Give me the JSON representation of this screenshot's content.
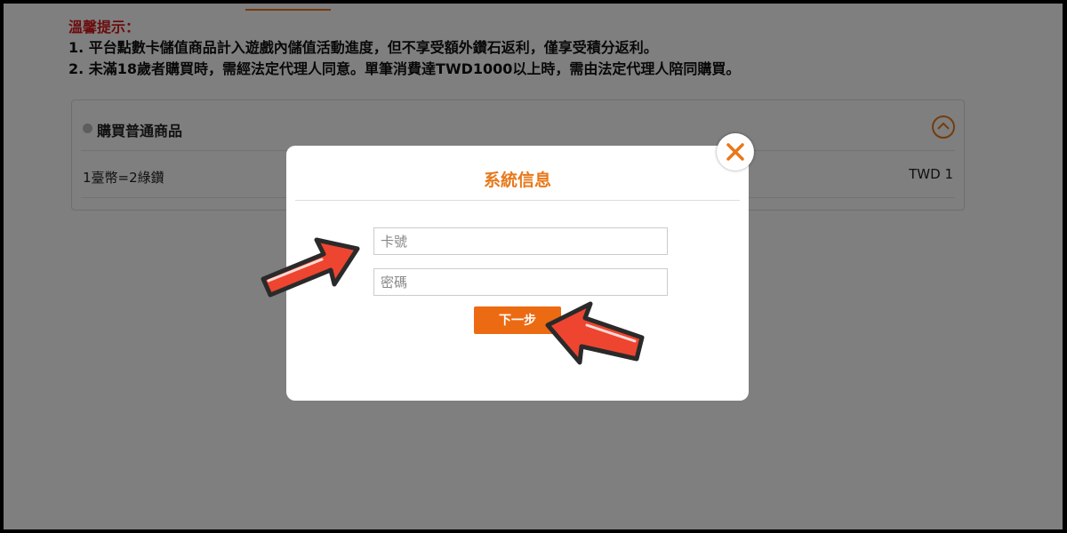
{
  "notice": {
    "title": "溫馨提示：",
    "lines": [
      "1. 平台點數卡儲值商品計入遊戲內儲值活動進度，但不享受額外鑽石返利，僅享受積分返利。",
      "2. 未滿18歲者購買時，需經法定代理人同意。單筆消費達TWD1000以上時，需由法定代理人陪同購買。"
    ]
  },
  "product": {
    "header": "購買普通商品",
    "rate": "1臺幣=2綠鑽",
    "price": "TWD 1"
  },
  "modal": {
    "title": "系統信息",
    "card_placeholder": "卡號",
    "password_placeholder": "密碼",
    "next_label": "下一步"
  },
  "colors": {
    "accent": "#e8781a",
    "button": "#ec6a12",
    "notice_title": "#d8181c",
    "arrow": "#ee4530"
  },
  "icons": {
    "close": "close-icon",
    "collapse": "chevron-up-icon",
    "pointer": "arrow-pointer-icon"
  }
}
